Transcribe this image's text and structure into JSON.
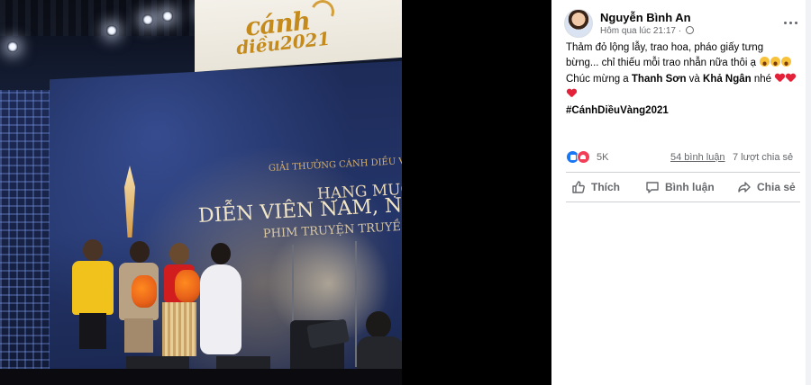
{
  "photo": {
    "logo": {
      "word": "cánh",
      "subword": "diều2021"
    },
    "screen_lines": [
      "GIẢI THƯỞNG CÁNH DIỀU VÀ",
      "HẠNG MỤC",
      "DIỄN VIÊN NAM, NỮ CHÍ",
      "PHIM TRUYỆN TRUYỀ"
    ]
  },
  "post": {
    "author": "Nguyễn Bình An",
    "timestamp": "Hôm qua lúc 21:17",
    "privacy_icon": "globe-icon",
    "more_icon": "more-dots-icon",
    "body": {
      "line1": "Thảm đỏ lộng lẫy, trao hoa, pháo giấy tưng bừng... chỉ thiếu mỗi trao nhẫn nữa thôi ạ",
      "line2_prefix": "Chúc mừng a ",
      "name1": "Thanh Sơn",
      "line2_mid": " và ",
      "name2": "Khả Ngân",
      "line2_suffix": " nhé",
      "hashtag": "#CánhDiềuVàng2021"
    },
    "stats": {
      "reaction_count": "5K",
      "comments": "54 bình luận",
      "shares": "7 lượt chia sẻ"
    },
    "actions": {
      "like": "Thích",
      "comment": "Bình luận",
      "share": "Chia sẻ"
    },
    "colors": {
      "like_blue": "#1877f2",
      "love_red": "#f33e58",
      "secondary_text": "#65676b"
    }
  }
}
